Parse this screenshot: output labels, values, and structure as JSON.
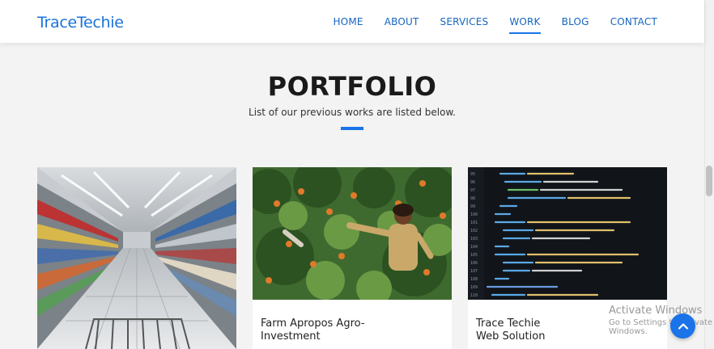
{
  "brand": "TraceTechie",
  "nav": {
    "items": [
      {
        "label": "HOME"
      },
      {
        "label": "ABOUT"
      },
      {
        "label": "SERVICES"
      },
      {
        "label": "WORK"
      },
      {
        "label": "BLOG"
      },
      {
        "label": "CONTACT"
      }
    ],
    "active": "WORK"
  },
  "section": {
    "title": "PORTFOLIO",
    "subtitle": "List of our previous works are listed below."
  },
  "portfolio": [
    {
      "image": "supermarket-aisle",
      "caption": ""
    },
    {
      "image": "orange-harvest",
      "caption": "Farm Apropos Agro-Investment"
    },
    {
      "image": "code-editor",
      "caption": "Trace Techie Web Solution"
    }
  ],
  "watermark": {
    "line1": "Activate Windows",
    "line2": "Go to Settings to activate Windows."
  },
  "colors": {
    "accent": "#1a73e8",
    "background": "#f3f3f3"
  },
  "icons": {
    "back_to_top": "chevron-up-icon"
  }
}
